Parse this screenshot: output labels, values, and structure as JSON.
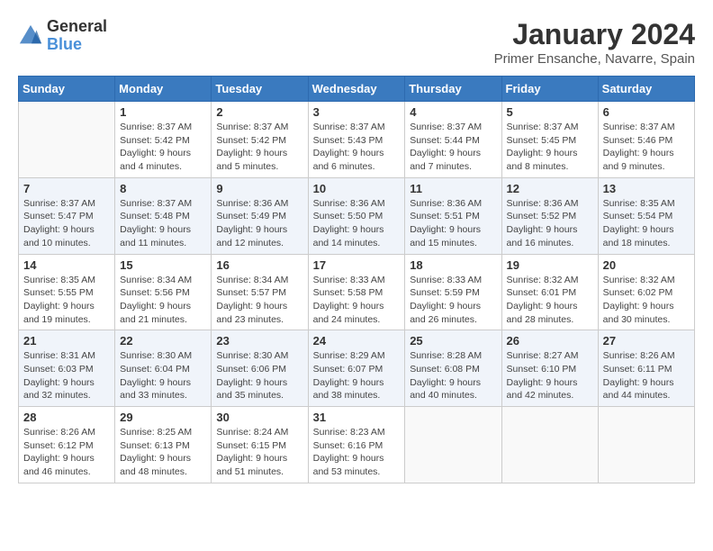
{
  "logo": {
    "general": "General",
    "blue": "Blue"
  },
  "title": "January 2024",
  "subtitle": "Primer Ensanche, Navarre, Spain",
  "days_of_week": [
    "Sunday",
    "Monday",
    "Tuesday",
    "Wednesday",
    "Thursday",
    "Friday",
    "Saturday"
  ],
  "weeks": [
    [
      {
        "day": "",
        "info": ""
      },
      {
        "day": "1",
        "info": "Sunrise: 8:37 AM\nSunset: 5:42 PM\nDaylight: 9 hours\nand 4 minutes."
      },
      {
        "day": "2",
        "info": "Sunrise: 8:37 AM\nSunset: 5:42 PM\nDaylight: 9 hours\nand 5 minutes."
      },
      {
        "day": "3",
        "info": "Sunrise: 8:37 AM\nSunset: 5:43 PM\nDaylight: 9 hours\nand 6 minutes."
      },
      {
        "day": "4",
        "info": "Sunrise: 8:37 AM\nSunset: 5:44 PM\nDaylight: 9 hours\nand 7 minutes."
      },
      {
        "day": "5",
        "info": "Sunrise: 8:37 AM\nSunset: 5:45 PM\nDaylight: 9 hours\nand 8 minutes."
      },
      {
        "day": "6",
        "info": "Sunrise: 8:37 AM\nSunset: 5:46 PM\nDaylight: 9 hours\nand 9 minutes."
      }
    ],
    [
      {
        "day": "7",
        "info": "Sunrise: 8:37 AM\nSunset: 5:47 PM\nDaylight: 9 hours\nand 10 minutes."
      },
      {
        "day": "8",
        "info": "Sunrise: 8:37 AM\nSunset: 5:48 PM\nDaylight: 9 hours\nand 11 minutes."
      },
      {
        "day": "9",
        "info": "Sunrise: 8:36 AM\nSunset: 5:49 PM\nDaylight: 9 hours\nand 12 minutes."
      },
      {
        "day": "10",
        "info": "Sunrise: 8:36 AM\nSunset: 5:50 PM\nDaylight: 9 hours\nand 14 minutes."
      },
      {
        "day": "11",
        "info": "Sunrise: 8:36 AM\nSunset: 5:51 PM\nDaylight: 9 hours\nand 15 minutes."
      },
      {
        "day": "12",
        "info": "Sunrise: 8:36 AM\nSunset: 5:52 PM\nDaylight: 9 hours\nand 16 minutes."
      },
      {
        "day": "13",
        "info": "Sunrise: 8:35 AM\nSunset: 5:54 PM\nDaylight: 9 hours\nand 18 minutes."
      }
    ],
    [
      {
        "day": "14",
        "info": "Sunrise: 8:35 AM\nSunset: 5:55 PM\nDaylight: 9 hours\nand 19 minutes."
      },
      {
        "day": "15",
        "info": "Sunrise: 8:34 AM\nSunset: 5:56 PM\nDaylight: 9 hours\nand 21 minutes."
      },
      {
        "day": "16",
        "info": "Sunrise: 8:34 AM\nSunset: 5:57 PM\nDaylight: 9 hours\nand 23 minutes."
      },
      {
        "day": "17",
        "info": "Sunrise: 8:33 AM\nSunset: 5:58 PM\nDaylight: 9 hours\nand 24 minutes."
      },
      {
        "day": "18",
        "info": "Sunrise: 8:33 AM\nSunset: 5:59 PM\nDaylight: 9 hours\nand 26 minutes."
      },
      {
        "day": "19",
        "info": "Sunrise: 8:32 AM\nSunset: 6:01 PM\nDaylight: 9 hours\nand 28 minutes."
      },
      {
        "day": "20",
        "info": "Sunrise: 8:32 AM\nSunset: 6:02 PM\nDaylight: 9 hours\nand 30 minutes."
      }
    ],
    [
      {
        "day": "21",
        "info": "Sunrise: 8:31 AM\nSunset: 6:03 PM\nDaylight: 9 hours\nand 32 minutes."
      },
      {
        "day": "22",
        "info": "Sunrise: 8:30 AM\nSunset: 6:04 PM\nDaylight: 9 hours\nand 33 minutes."
      },
      {
        "day": "23",
        "info": "Sunrise: 8:30 AM\nSunset: 6:06 PM\nDaylight: 9 hours\nand 35 minutes."
      },
      {
        "day": "24",
        "info": "Sunrise: 8:29 AM\nSunset: 6:07 PM\nDaylight: 9 hours\nand 38 minutes."
      },
      {
        "day": "25",
        "info": "Sunrise: 8:28 AM\nSunset: 6:08 PM\nDaylight: 9 hours\nand 40 minutes."
      },
      {
        "day": "26",
        "info": "Sunrise: 8:27 AM\nSunset: 6:10 PM\nDaylight: 9 hours\nand 42 minutes."
      },
      {
        "day": "27",
        "info": "Sunrise: 8:26 AM\nSunset: 6:11 PM\nDaylight: 9 hours\nand 44 minutes."
      }
    ],
    [
      {
        "day": "28",
        "info": "Sunrise: 8:26 AM\nSunset: 6:12 PM\nDaylight: 9 hours\nand 46 minutes."
      },
      {
        "day": "29",
        "info": "Sunrise: 8:25 AM\nSunset: 6:13 PM\nDaylight: 9 hours\nand 48 minutes."
      },
      {
        "day": "30",
        "info": "Sunrise: 8:24 AM\nSunset: 6:15 PM\nDaylight: 9 hours\nand 51 minutes."
      },
      {
        "day": "31",
        "info": "Sunrise: 8:23 AM\nSunset: 6:16 PM\nDaylight: 9 hours\nand 53 minutes."
      },
      {
        "day": "",
        "info": ""
      },
      {
        "day": "",
        "info": ""
      },
      {
        "day": "",
        "info": ""
      }
    ]
  ]
}
